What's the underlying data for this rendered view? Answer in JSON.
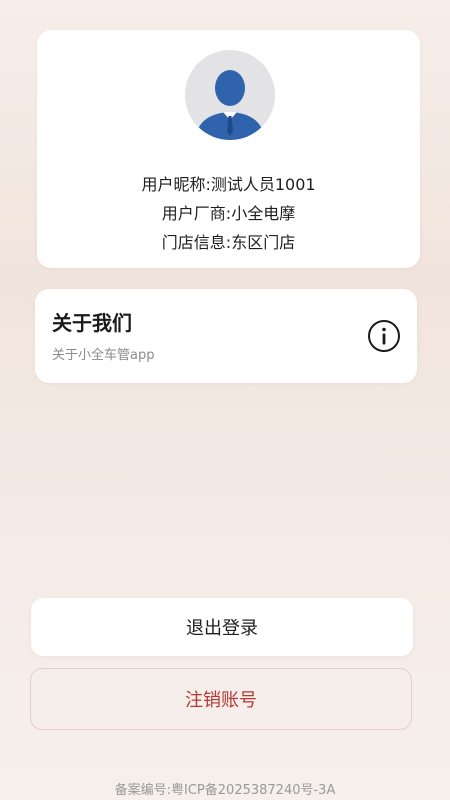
{
  "profile": {
    "nickname_line": "用户昵称:测试人员1001",
    "vendor_line": "用户厂商:小全电摩",
    "store_line": "门店信息:东区门店"
  },
  "about": {
    "title": "关于我们",
    "subtitle": "关于小全车管app",
    "icon": "info-circle-icon"
  },
  "actions": {
    "logout_label": "退出登录",
    "cancel_account_label": "注销账号"
  },
  "footer": {
    "icp_text": "备案编号:粤ICP备2025387240号-3A"
  },
  "colors": {
    "danger": "#b23a34",
    "avatar_blue": "#2f64ac",
    "avatar_bg": "#e3e3e5"
  }
}
